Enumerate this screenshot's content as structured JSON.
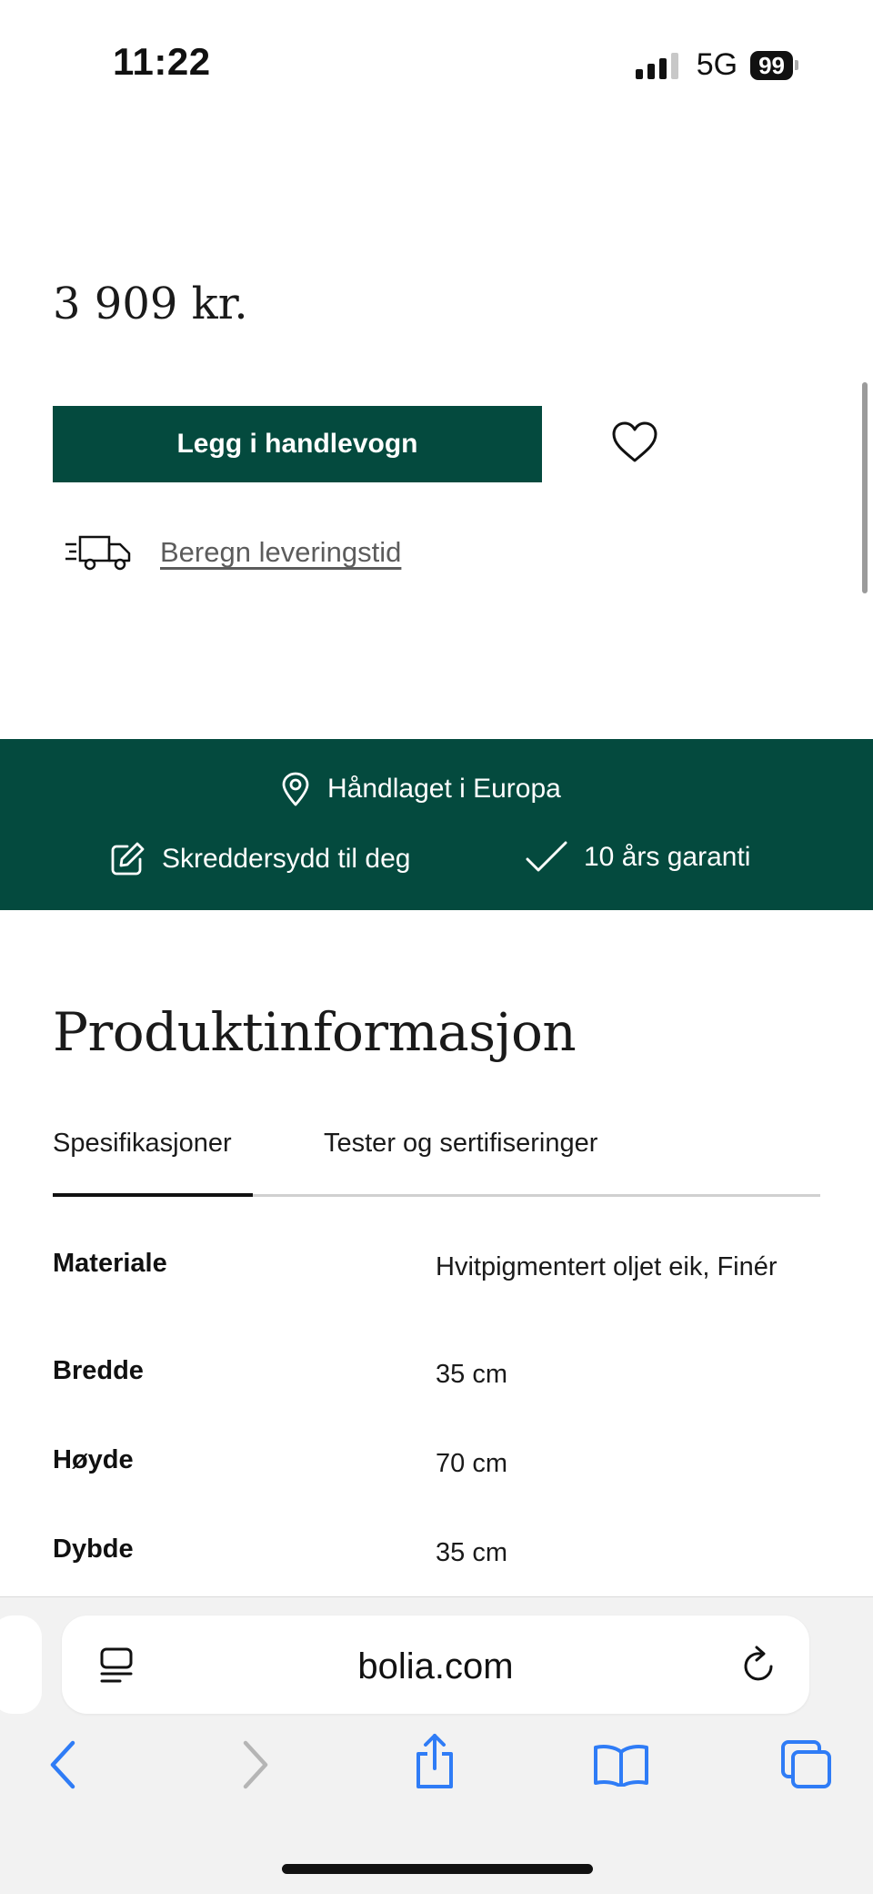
{
  "status_bar": {
    "time": "11:22",
    "network": "5G",
    "battery": "99"
  },
  "product": {
    "price": "3 909 kr.",
    "add_to_cart_label": "Legg i handlevogn",
    "delivery_link": "Beregn leveringstid"
  },
  "usp_band": {
    "items": [
      {
        "icon": "location-pin-icon",
        "label": "Håndlaget i Europa"
      },
      {
        "icon": "edit-pencil-icon",
        "label": "Skreddersydd til deg"
      },
      {
        "icon": "checkmark-icon",
        "label": "10 års garanti"
      }
    ],
    "background_color": "#044a3e"
  },
  "product_info": {
    "title": "Produktinformasjon",
    "tabs": [
      {
        "label": "Spesifikasjoner",
        "active": true
      },
      {
        "label": "Tester og sertifiseringer",
        "active": false
      }
    ],
    "specs": [
      {
        "label": "Materiale",
        "value": "Hvitpigmentert oljet eik, Finér"
      },
      {
        "label": "Bredde",
        "value": "35 cm"
      },
      {
        "label": "Høyde",
        "value": "70 cm"
      },
      {
        "label": "Dybde",
        "value": "35 cm"
      }
    ]
  },
  "browser": {
    "url": "bolia.com",
    "toolbar": [
      "back-icon",
      "forward-icon",
      "share-icon",
      "bookmarks-icon",
      "tabs-icon"
    ],
    "accent_color": "#2f7cf6"
  }
}
